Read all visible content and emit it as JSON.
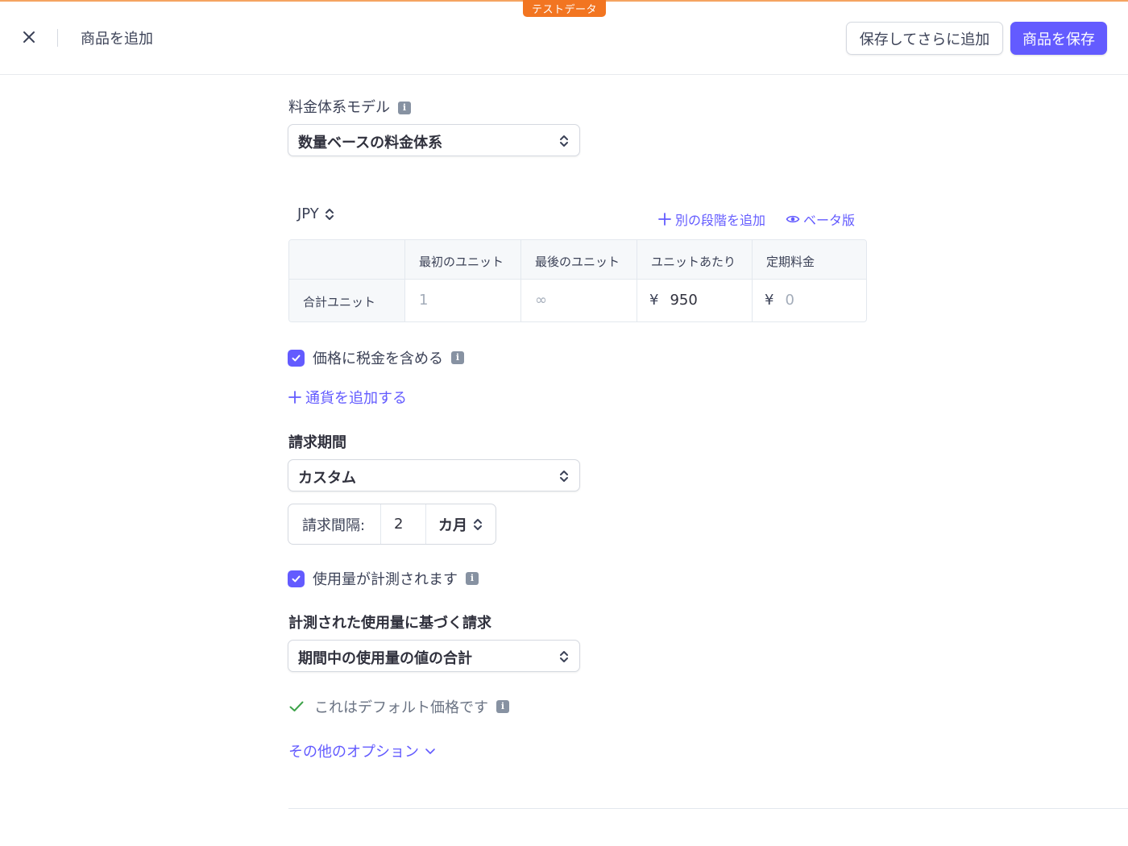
{
  "badge": "テストデータ",
  "header": {
    "title": "商品を追加",
    "save_and_add_label": "保存してさらに追加",
    "save_label": "商品を保存"
  },
  "pricing_model": {
    "label": "料金体系モデル",
    "value": "数量ベースの料金体系"
  },
  "currency": {
    "value": "JPY",
    "add_tier_label": "別の段階を追加",
    "beta_label": "ベータ版"
  },
  "tier_table": {
    "headers": [
      "最初のユニット",
      "最後のユニット",
      "ユニットあたり",
      "定期料金"
    ],
    "row_label": "合計ユニット",
    "first_unit_placeholder": "1",
    "last_unit_placeholder": "∞",
    "currency_symbol": "¥",
    "per_unit_value": "950",
    "flat_fee_placeholder": "0"
  },
  "include_tax": {
    "label": "価格に税金を含める",
    "checked": true
  },
  "add_currency_label": "通貨を追加する",
  "billing_period": {
    "label": "請求期間",
    "value": "カスタム"
  },
  "billing_interval": {
    "label": "請求間隔:",
    "count": "2",
    "unit": "カ月"
  },
  "usage_metered": {
    "label": "使用量が計測されます",
    "checked": true
  },
  "metered_billing": {
    "label": "計測された使用量に基づく請求",
    "value": "期間中の使用量の値の合計"
  },
  "default_price_label": "これはデフォルト価格です",
  "more_options_label": "その他のオプション",
  "colors": {
    "accent": "#635bff",
    "test_badge": "#f27521",
    "success": "#3ea34a"
  }
}
